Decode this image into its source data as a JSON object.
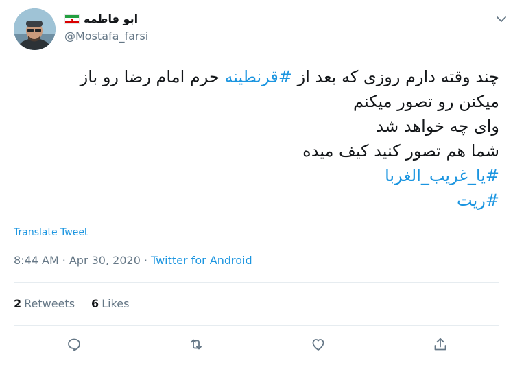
{
  "author": {
    "display_name": "ابو فاطمه",
    "handle": "@Mostafa_farsi",
    "avatar_icon": "profile-photo",
    "flag_icon": "iran-flag"
  },
  "tweet": {
    "lines": [
      {
        "before": "چند وقته دارم روزی که بعد از ",
        "hashtag": "#قرنطینه",
        "after": " حرم امام رضا رو باز"
      },
      {
        "before": "میکنن رو تصور میکنم",
        "hashtag": "",
        "after": ""
      },
      {
        "before": "وای چه خواهد شد",
        "hashtag": "",
        "after": ""
      },
      {
        "before": "شما هم تصور کنید کیف میده",
        "hashtag": "",
        "after": ""
      },
      {
        "before": "",
        "hashtag": "#یا_غریب_الغربا",
        "after": ""
      },
      {
        "before": "",
        "hashtag": "#ریت",
        "after": ""
      }
    ]
  },
  "translate_label": "Translate Tweet",
  "meta": {
    "time": "8:44 AM",
    "separator": "·",
    "date": "Apr 30, 2020",
    "separator2": "·",
    "source": "Twitter for Android"
  },
  "stats": {
    "retweets_count": "2",
    "retweets_label": "Retweets",
    "likes_count": "6",
    "likes_label": "Likes"
  },
  "colors": {
    "link": "#1b95e0",
    "muted": "#657786",
    "text": "#14171a",
    "divider": "#e6ecf0"
  },
  "actions": [
    "reply-icon",
    "retweet-icon",
    "like-icon",
    "share-icon"
  ]
}
